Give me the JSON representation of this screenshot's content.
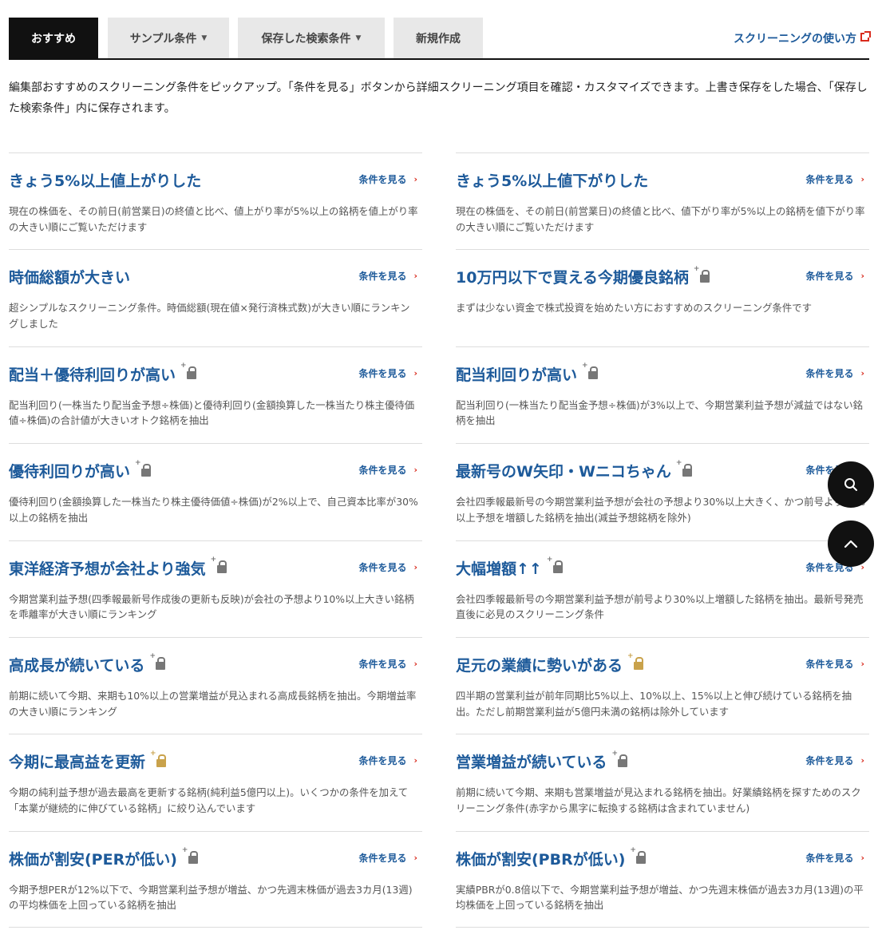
{
  "tabs": [
    {
      "label": "おすすめ",
      "active": true
    },
    {
      "label": "サンプル条件",
      "dropdown": true
    },
    {
      "label": "保存した検索条件",
      "dropdown": true
    },
    {
      "label": "新規作成"
    }
  ],
  "howto_link": "スクリーニングの使い方",
  "intro": "編集部おすすめのスクリーニング条件をピックアップ。「条件を見る」ボタンから詳細スクリーニング項目を確認・カスタマイズできます。上書き保存をした場合、「保存した検索条件」内に保存されます。",
  "see_label": "条件を見る",
  "cards_left": [
    {
      "title": "きょう5%以上値上がりした",
      "lock": "none",
      "desc": "現在の株価を、その前日(前営業日)の終値と比べ、値上がり率が5%以上の銘柄を値上がり率の大きい順にご覧いただけます"
    },
    {
      "title": "時価総額が大きい",
      "lock": "none",
      "desc": "超シンプルなスクリーニング条件。時価総額(現在値×発行済株式数)が大きい順にランキングしました"
    },
    {
      "title": "配当＋優待利回りが高い",
      "lock": "gray",
      "desc": "配当利回り(一株当たり配当金予想÷株価)と優待利回り(金額換算した一株当たり株主優待価値÷株価)の合計値が大きいオトク銘柄を抽出"
    },
    {
      "title": "優待利回りが高い",
      "lock": "gray",
      "desc": "優待利回り(金額換算した一株当たり株主優待価値÷株価)が2%以上で、自己資本比率が30%以上の銘柄を抽出"
    },
    {
      "title": "東洋経済予想が会社より強気",
      "lock": "gray",
      "desc": "今期営業利益予想(四季報最新号作成後の更新も反映)が会社の予想より10%以上大きい銘柄を乖離率が大きい順にランキング"
    },
    {
      "title": "高成長が続いている",
      "lock": "gray",
      "desc": "前期に続いて今期、来期も10%以上の営業増益が見込まれる高成長銘柄を抽出。今期増益率の大きい順にランキング"
    },
    {
      "title": "今期に最高益を更新",
      "lock": "gold",
      "desc": "今期の純利益予想が過去最高を更新する銘柄(純利益5億円以上)。いくつかの条件を加えて「本業が継続的に伸びている銘柄」に絞り込んでいます"
    },
    {
      "title": "株価が割安(PERが低い)",
      "lock": "gray",
      "desc": "今期予想PERが12%以下で、今期営業利益予想が増益、かつ先週末株価が過去3カ月(13週)の平均株価を上回っている銘柄を抽出"
    }
  ],
  "cards_right": [
    {
      "title": "きょう5%以上値下がりした",
      "lock": "none",
      "desc": "現在の株価を、その前日(前営業日)の終値と比べ、値下がり率が5%以上の銘柄を値下がり率の大きい順にご覧いただけます"
    },
    {
      "title": "10万円以下で買える今期優良銘柄",
      "lock": "gray",
      "desc": "まずは少ない資金で株式投資を始めたい方におすすめのスクリーニング条件です"
    },
    {
      "title": "配当利回りが高い",
      "lock": "gray",
      "desc": "配当利回り(一株当たり配当金予想÷株価)が3%以上で、今期営業利益予想が減益ではない銘柄を抽出"
    },
    {
      "title": "最新号のW矢印・Wニコちゃん",
      "lock": "gray",
      "desc": "会社四季報最新号の今期営業利益予想が会社の予想より30%以上大きく、かつ前号より30%以上予想を増額した銘柄を抽出(減益予想銘柄を除外)"
    },
    {
      "title": "大幅増額↑↑",
      "lock": "gray",
      "desc": "会社四季報最新号の今期営業利益予想が前号より30%以上増額した銘柄を抽出。最新号発売直後に必見のスクリーニング条件"
    },
    {
      "title": "足元の業績に勢いがある",
      "lock": "gold",
      "desc": "四半期の営業利益が前年同期比5%以上、10%以上、15%以上と伸び続けている銘柄を抽出。ただし前期営業利益が5億円未満の銘柄は除外しています"
    },
    {
      "title": "営業増益が続いている",
      "lock": "gray",
      "desc": "前期に続いて今期、来期も営業増益が見込まれる銘柄を抽出。好業績銘柄を探すためのスクリーニング条件(赤字から黒字に転換する銘柄は含まれていません)"
    },
    {
      "title": "株価が割安(PBRが低い)",
      "lock": "gray",
      "desc": "実績PBRが0.8倍以下で、今期営業利益予想が増益、かつ先週末株価が過去3カ月(13週)の平均株価を上回っている銘柄を抽出"
    }
  ],
  "floating_buttons": {
    "search_icon": "search-icon",
    "scroll_top_icon": "chevron-up-icon"
  }
}
